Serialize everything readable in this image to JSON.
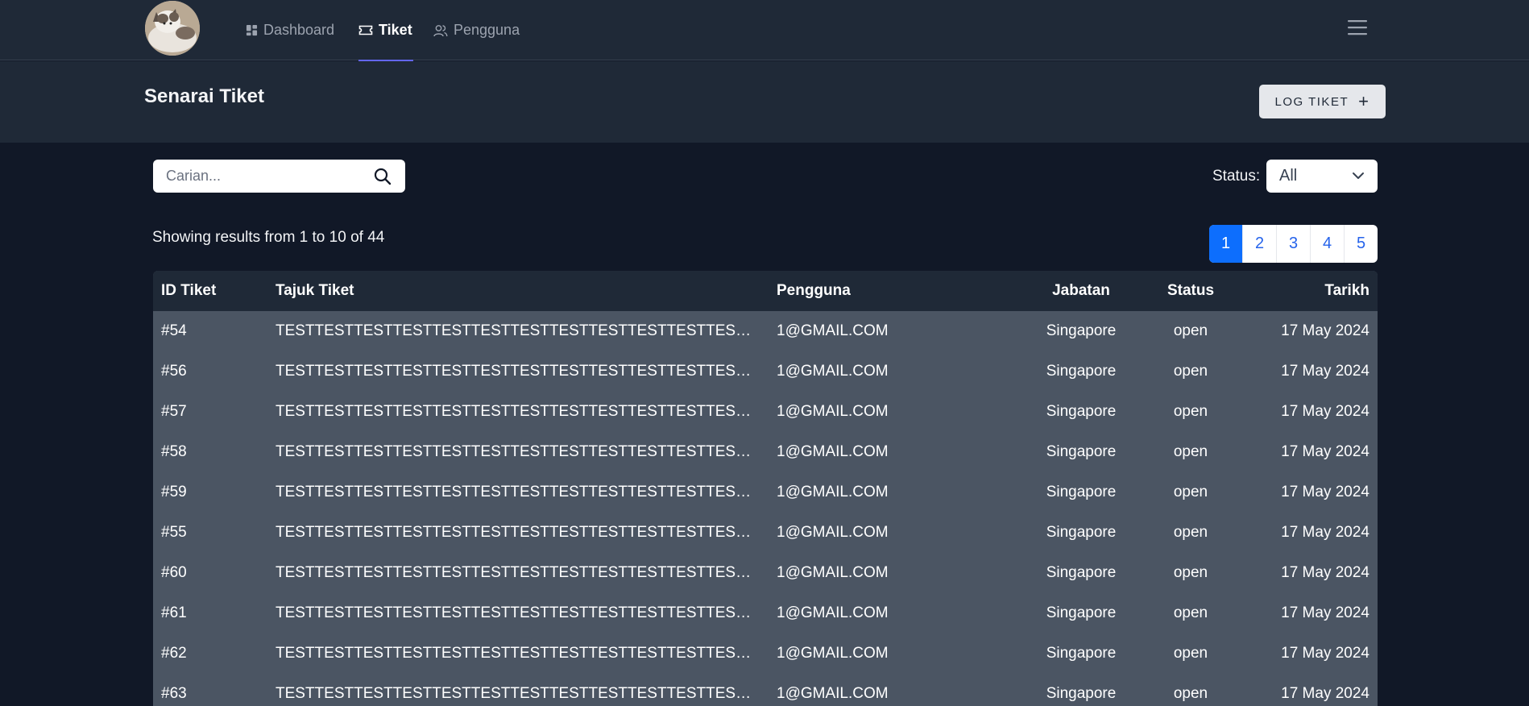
{
  "nav": {
    "items": [
      {
        "label": "Dashboard",
        "icon": "dashboard-icon",
        "active": false
      },
      {
        "label": "Tiket",
        "icon": "ticket-icon",
        "active": true
      },
      {
        "label": "Pengguna",
        "icon": "users-icon",
        "active": false
      }
    ]
  },
  "header": {
    "title": "Senarai Tiket",
    "log_button": "LOG TIKET"
  },
  "search": {
    "placeholder": "Carian..."
  },
  "filter": {
    "label": "Status:",
    "selected": "All"
  },
  "results_text": "Showing results from 1 to 10 of 44",
  "pagination": {
    "pages": [
      "1",
      "2",
      "3",
      "4",
      "5"
    ],
    "active": "1"
  },
  "table": {
    "columns": [
      "ID Tiket",
      "Tajuk Tiket",
      "Pengguna",
      "Jabatan",
      "Status",
      "Tarikh"
    ],
    "rows": [
      {
        "id": "#54",
        "title": "TESTTESTTESTTESTTESTTESTTESTTESTTESTTESTTESTTESTTESTTES...",
        "user": "1@GMAIL.COM",
        "dept": "Singapore",
        "status": "open",
        "date": "17 May 2024"
      },
      {
        "id": "#56",
        "title": "TESTTESTTESTTESTTESTTESTTESTTESTTESTTESTTESTTESTTESTTES...",
        "user": "1@GMAIL.COM",
        "dept": "Singapore",
        "status": "open",
        "date": "17 May 2024"
      },
      {
        "id": "#57",
        "title": "TESTTESTTESTTESTTESTTESTTESTTESTTESTTESTTESTTESTTESTTES...",
        "user": "1@GMAIL.COM",
        "dept": "Singapore",
        "status": "open",
        "date": "17 May 2024"
      },
      {
        "id": "#58",
        "title": "TESTTESTTESTTESTTESTTESTTESTTESTTESTTESTTESTTESTTESTTES...",
        "user": "1@GMAIL.COM",
        "dept": "Singapore",
        "status": "open",
        "date": "17 May 2024"
      },
      {
        "id": "#59",
        "title": "TESTTESTTESTTESTTESTTESTTESTTESTTESTTESTTESTTESTTESTTES...",
        "user": "1@GMAIL.COM",
        "dept": "Singapore",
        "status": "open",
        "date": "17 May 2024"
      },
      {
        "id": "#55",
        "title": "TESTTESTTESTTESTTESTTESTTESTTESTTESTTESTTESTTESTTESTTES...",
        "user": "1@GMAIL.COM",
        "dept": "Singapore",
        "status": "open",
        "date": "17 May 2024"
      },
      {
        "id": "#60",
        "title": "TESTTESTTESTTESTTESTTESTTESTTESTTESTTESTTESTTESTTESTTES...",
        "user": "1@GMAIL.COM",
        "dept": "Singapore",
        "status": "open",
        "date": "17 May 2024"
      },
      {
        "id": "#61",
        "title": "TESTTESTTESTTESTTESTTESTTESTTESTTESTTESTTESTTESTTESTTES...",
        "user": "1@GMAIL.COM",
        "dept": "Singapore",
        "status": "open",
        "date": "17 May 2024"
      },
      {
        "id": "#62",
        "title": "TESTTESTTESTTESTTESTTESTTESTTESTTESTTESTTESTTESTTESTTES...",
        "user": "1@GMAIL.COM",
        "dept": "Singapore",
        "status": "open",
        "date": "17 May 2024"
      },
      {
        "id": "#63",
        "title": "TESTTESTTESTTESTTESTTESTTESTTESTTESTTESTTESTTESTTESTTES...",
        "user": "1@GMAIL.COM",
        "dept": "Singapore",
        "status": "open",
        "date": "17 May 2024"
      }
    ]
  },
  "colors": {
    "accent": "#6366f1",
    "primary": "#0d6efd",
    "bg": "#111827",
    "panel": "#1f2937",
    "row": "#4b5563"
  }
}
